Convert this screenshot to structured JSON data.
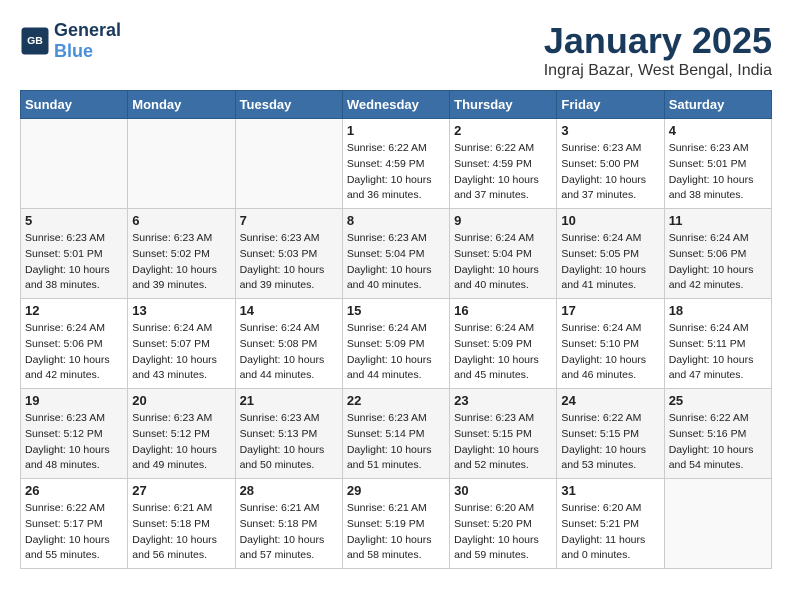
{
  "header": {
    "logo_line1": "General",
    "logo_line2": "Blue",
    "month": "January 2025",
    "location": "Ingraj Bazar, West Bengal, India"
  },
  "weekdays": [
    "Sunday",
    "Monday",
    "Tuesday",
    "Wednesday",
    "Thursday",
    "Friday",
    "Saturday"
  ],
  "weeks": [
    [
      {
        "day": "",
        "info": ""
      },
      {
        "day": "",
        "info": ""
      },
      {
        "day": "",
        "info": ""
      },
      {
        "day": "1",
        "info": "Sunrise: 6:22 AM\nSunset: 4:59 PM\nDaylight: 10 hours\nand 36 minutes."
      },
      {
        "day": "2",
        "info": "Sunrise: 6:22 AM\nSunset: 4:59 PM\nDaylight: 10 hours\nand 37 minutes."
      },
      {
        "day": "3",
        "info": "Sunrise: 6:23 AM\nSunset: 5:00 PM\nDaylight: 10 hours\nand 37 minutes."
      },
      {
        "day": "4",
        "info": "Sunrise: 6:23 AM\nSunset: 5:01 PM\nDaylight: 10 hours\nand 38 minutes."
      }
    ],
    [
      {
        "day": "5",
        "info": "Sunrise: 6:23 AM\nSunset: 5:01 PM\nDaylight: 10 hours\nand 38 minutes."
      },
      {
        "day": "6",
        "info": "Sunrise: 6:23 AM\nSunset: 5:02 PM\nDaylight: 10 hours\nand 39 minutes."
      },
      {
        "day": "7",
        "info": "Sunrise: 6:23 AM\nSunset: 5:03 PM\nDaylight: 10 hours\nand 39 minutes."
      },
      {
        "day": "8",
        "info": "Sunrise: 6:23 AM\nSunset: 5:04 PM\nDaylight: 10 hours\nand 40 minutes."
      },
      {
        "day": "9",
        "info": "Sunrise: 6:24 AM\nSunset: 5:04 PM\nDaylight: 10 hours\nand 40 minutes."
      },
      {
        "day": "10",
        "info": "Sunrise: 6:24 AM\nSunset: 5:05 PM\nDaylight: 10 hours\nand 41 minutes."
      },
      {
        "day": "11",
        "info": "Sunrise: 6:24 AM\nSunset: 5:06 PM\nDaylight: 10 hours\nand 42 minutes."
      }
    ],
    [
      {
        "day": "12",
        "info": "Sunrise: 6:24 AM\nSunset: 5:06 PM\nDaylight: 10 hours\nand 42 minutes."
      },
      {
        "day": "13",
        "info": "Sunrise: 6:24 AM\nSunset: 5:07 PM\nDaylight: 10 hours\nand 43 minutes."
      },
      {
        "day": "14",
        "info": "Sunrise: 6:24 AM\nSunset: 5:08 PM\nDaylight: 10 hours\nand 44 minutes."
      },
      {
        "day": "15",
        "info": "Sunrise: 6:24 AM\nSunset: 5:09 PM\nDaylight: 10 hours\nand 44 minutes."
      },
      {
        "day": "16",
        "info": "Sunrise: 6:24 AM\nSunset: 5:09 PM\nDaylight: 10 hours\nand 45 minutes."
      },
      {
        "day": "17",
        "info": "Sunrise: 6:24 AM\nSunset: 5:10 PM\nDaylight: 10 hours\nand 46 minutes."
      },
      {
        "day": "18",
        "info": "Sunrise: 6:24 AM\nSunset: 5:11 PM\nDaylight: 10 hours\nand 47 minutes."
      }
    ],
    [
      {
        "day": "19",
        "info": "Sunrise: 6:23 AM\nSunset: 5:12 PM\nDaylight: 10 hours\nand 48 minutes."
      },
      {
        "day": "20",
        "info": "Sunrise: 6:23 AM\nSunset: 5:12 PM\nDaylight: 10 hours\nand 49 minutes."
      },
      {
        "day": "21",
        "info": "Sunrise: 6:23 AM\nSunset: 5:13 PM\nDaylight: 10 hours\nand 50 minutes."
      },
      {
        "day": "22",
        "info": "Sunrise: 6:23 AM\nSunset: 5:14 PM\nDaylight: 10 hours\nand 51 minutes."
      },
      {
        "day": "23",
        "info": "Sunrise: 6:23 AM\nSunset: 5:15 PM\nDaylight: 10 hours\nand 52 minutes."
      },
      {
        "day": "24",
        "info": "Sunrise: 6:22 AM\nSunset: 5:15 PM\nDaylight: 10 hours\nand 53 minutes."
      },
      {
        "day": "25",
        "info": "Sunrise: 6:22 AM\nSunset: 5:16 PM\nDaylight: 10 hours\nand 54 minutes."
      }
    ],
    [
      {
        "day": "26",
        "info": "Sunrise: 6:22 AM\nSunset: 5:17 PM\nDaylight: 10 hours\nand 55 minutes."
      },
      {
        "day": "27",
        "info": "Sunrise: 6:21 AM\nSunset: 5:18 PM\nDaylight: 10 hours\nand 56 minutes."
      },
      {
        "day": "28",
        "info": "Sunrise: 6:21 AM\nSunset: 5:18 PM\nDaylight: 10 hours\nand 57 minutes."
      },
      {
        "day": "29",
        "info": "Sunrise: 6:21 AM\nSunset: 5:19 PM\nDaylight: 10 hours\nand 58 minutes."
      },
      {
        "day": "30",
        "info": "Sunrise: 6:20 AM\nSunset: 5:20 PM\nDaylight: 10 hours\nand 59 minutes."
      },
      {
        "day": "31",
        "info": "Sunrise: 6:20 AM\nSunset: 5:21 PM\nDaylight: 11 hours\nand 0 minutes."
      },
      {
        "day": "",
        "info": ""
      }
    ]
  ]
}
